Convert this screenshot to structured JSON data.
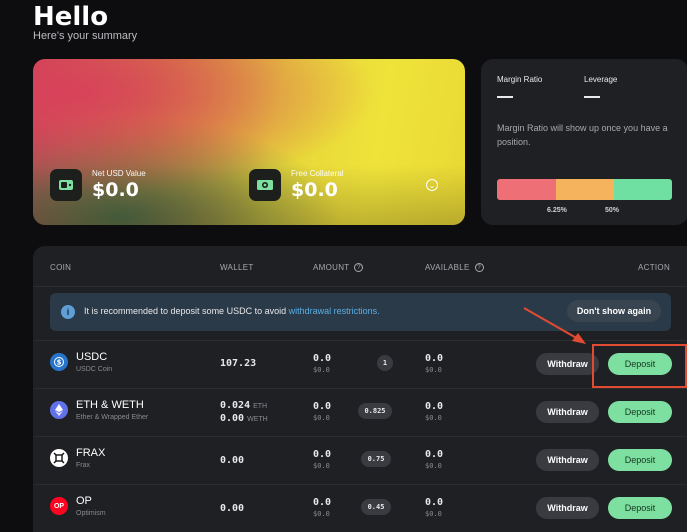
{
  "header": {
    "title": "Hello",
    "subtitle": "Here's your summary"
  },
  "summary": {
    "net_usd_label": "Net USD Value",
    "net_usd_value": "$0.0",
    "free_collateral_label": "Free Collateral",
    "free_collateral_value": "$0.0"
  },
  "margin": {
    "ratio_label": "Margin Ratio",
    "leverage_label": "Leverage",
    "note": "Margin Ratio will show up once you have a position.",
    "tick_1": "6.25%",
    "tick_2": "50%",
    "colors": [
      "#ee6f75",
      "#f5b35e",
      "#6fe0a2"
    ]
  },
  "table": {
    "headers": {
      "coin": "COIN",
      "wallet": "WALLET",
      "amount": "AMOUNT",
      "available": "AVAILABLE",
      "action": "ACTION"
    },
    "notice": {
      "text": "It is recommended to deposit some USDC to avoid",
      "link": "withdrawal restrictions.",
      "dismiss": "Don't show again"
    },
    "rows": [
      {
        "symbol": "USDC",
        "name": "USDC Coin",
        "wallet": "107.23",
        "wallet_unit": "",
        "wallet2": "",
        "wallet2_unit": "",
        "amount": "0.0",
        "amount_usd": "$0.0",
        "weight": "1",
        "available": "0.0",
        "available_usd": "$0.0",
        "withdraw": "Withdraw",
        "deposit": "Deposit",
        "icon_color": "#2775ca",
        "icon": "usdc-icon"
      },
      {
        "symbol": "ETH & WETH",
        "name": "Ether & Wrapped Ether",
        "wallet": "0.024",
        "wallet_unit": "ETH",
        "wallet2": "0.00",
        "wallet2_unit": "WETH",
        "amount": "0.0",
        "amount_usd": "$0.0",
        "weight": "0.825",
        "available": "0.0",
        "available_usd": "$0.0",
        "withdraw": "Withdraw",
        "deposit": "Deposit",
        "icon_color": "#6172e8",
        "icon": "eth-icon"
      },
      {
        "symbol": "FRAX",
        "name": "Frax",
        "wallet": "0.00",
        "wallet_unit": "",
        "wallet2": "",
        "wallet2_unit": "",
        "amount": "0.0",
        "amount_usd": "$0.0",
        "weight": "0.75",
        "available": "0.0",
        "available_usd": "$0.0",
        "withdraw": "Withdraw",
        "deposit": "Deposit",
        "icon_color": "#ffffff",
        "icon": "frax-icon"
      },
      {
        "symbol": "OP",
        "name": "Optimism",
        "wallet": "0.00",
        "wallet_unit": "",
        "wallet2": "",
        "wallet2_unit": "",
        "amount": "0.0",
        "amount_usd": "$0.0",
        "weight": "0.45",
        "available": "0.0",
        "available_usd": "$0.0",
        "withdraw": "Withdraw",
        "deposit": "Deposit",
        "icon_color": "#ff0420",
        "icon": "op-icon",
        "icon_text": "OP"
      }
    ]
  }
}
